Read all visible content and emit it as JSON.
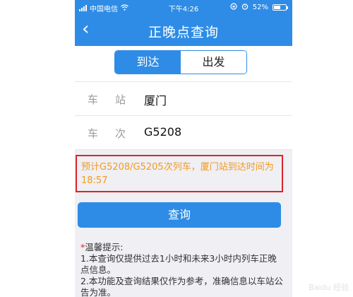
{
  "status_bar": {
    "carrier": "中国电信",
    "time": "下午4:26",
    "battery": "52%"
  },
  "nav": {
    "back_icon": "chevron-left-icon",
    "title": "正晚点查询"
  },
  "tabs": [
    {
      "label": "到达",
      "active": true
    },
    {
      "label": "出发",
      "active": false
    }
  ],
  "form": {
    "station": {
      "label": "车站",
      "value": "厦门"
    },
    "train": {
      "label": "车次",
      "value": "G5208"
    }
  },
  "result": {
    "text": "预计G5208/G5205次列车，厦门站到达时间为18:57"
  },
  "query_button": "查询",
  "tips": {
    "title": "温馨提示:",
    "lines": [
      "1.本查询仅提供过去1小时和未来3小时内列车正晚点信息。",
      "2.本功能及查询结果仅作为参考，准确信息以车站公告为准。"
    ]
  },
  "colors": {
    "primary": "#2e8ce6",
    "highlight_border": "#d9242a",
    "result_text": "#f39a20"
  },
  "watermark": "Baidu 经验"
}
